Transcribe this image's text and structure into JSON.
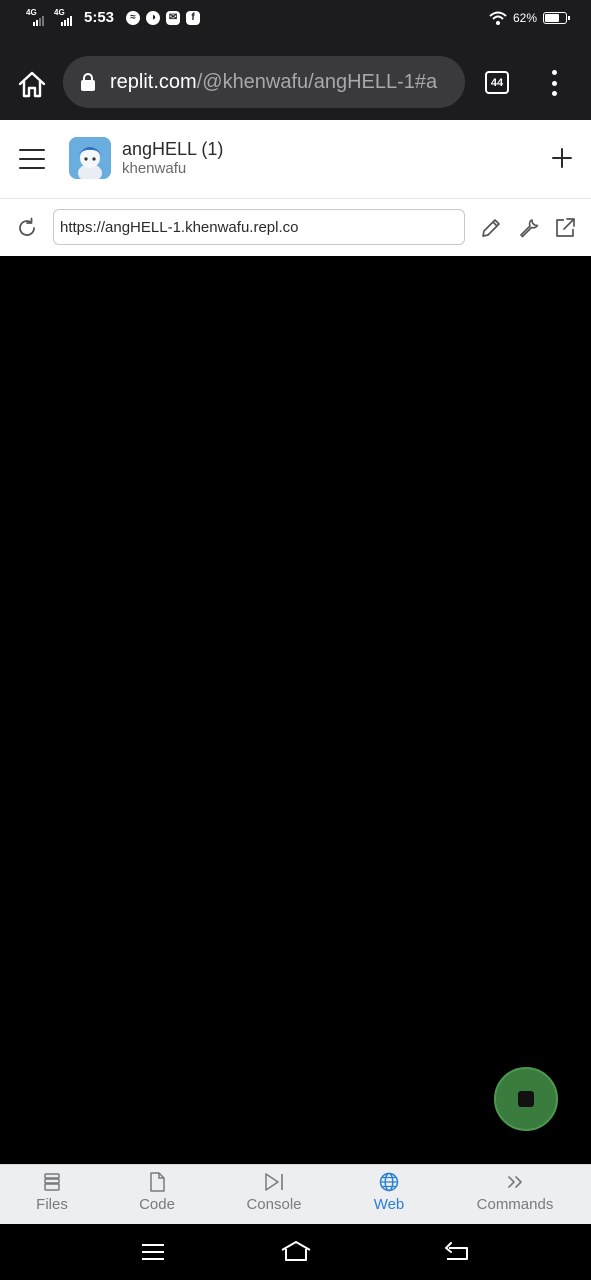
{
  "status_bar": {
    "network1": "4G",
    "network2": "4G",
    "time": "5:53",
    "battery_percent": "62%",
    "battery_level": 0.62,
    "notification_icons": [
      "messenger-icon",
      "feather-icon",
      "mail-icon",
      "facebook-icon"
    ]
  },
  "browser": {
    "url_host": "replit.com",
    "url_path": "/@khenwafu/angHELL-1#a",
    "tab_count": "44"
  },
  "repl": {
    "title": "angHELL (1)",
    "owner": "khenwafu"
  },
  "webview": {
    "url": "https://angHELL-1.khenwafu.repl.co"
  },
  "tabs": [
    {
      "label": "Files",
      "icon": "files-icon"
    },
    {
      "label": "Code",
      "icon": "file-icon"
    },
    {
      "label": "Console",
      "icon": "console-icon"
    },
    {
      "label": "Web",
      "icon": "globe-icon",
      "active": true
    },
    {
      "label": "Commands",
      "icon": "chevrons-right-icon"
    }
  ],
  "colors": {
    "accent": "#2a7fd4",
    "stop_button": "#3a7b3e",
    "browser_bar": "#1c1c1e"
  }
}
